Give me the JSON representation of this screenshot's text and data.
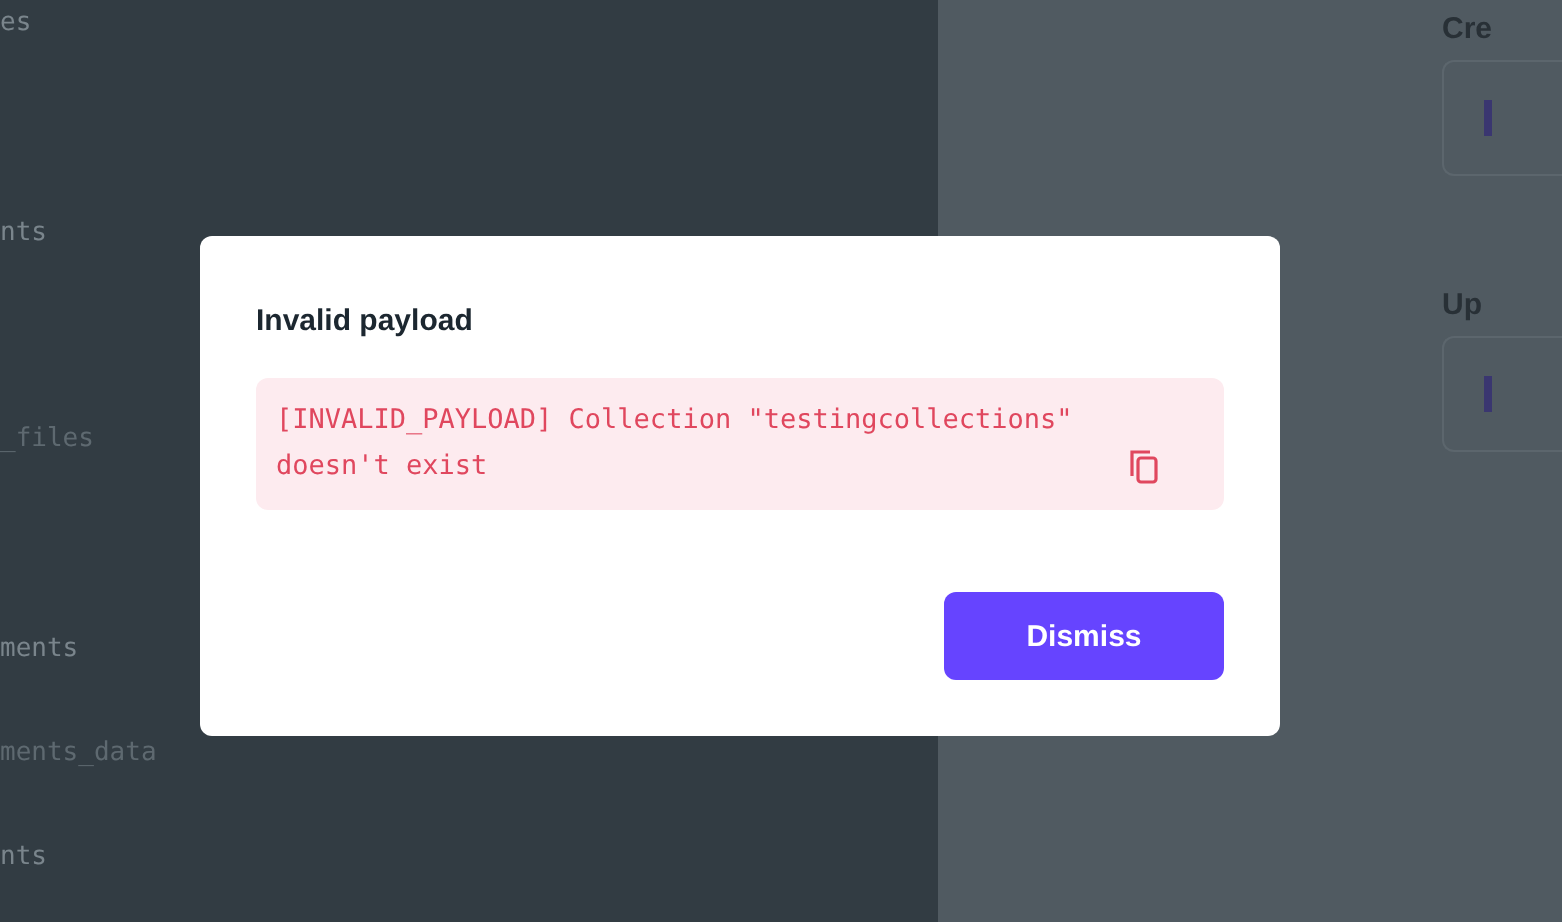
{
  "background": {
    "left_items": [
      {
        "text": "es",
        "kind": "name"
      },
      {
        "text": "nts",
        "kind": "name"
      },
      {
        "text": "_files",
        "kind": "note"
      },
      {
        "text": "ments",
        "kind": "name"
      },
      {
        "text": "ments_data",
        "kind": "note"
      },
      {
        "text": "nts",
        "kind": "name"
      }
    ],
    "right_sections": [
      {
        "label": "Cre"
      },
      {
        "label": "Up"
      }
    ]
  },
  "dialog": {
    "title": "Invalid payload",
    "error": "[INVALID_PAYLOAD] Collection \"testingcollections\" doesn't exist",
    "buttons": [
      "Dismiss"
    ]
  }
}
